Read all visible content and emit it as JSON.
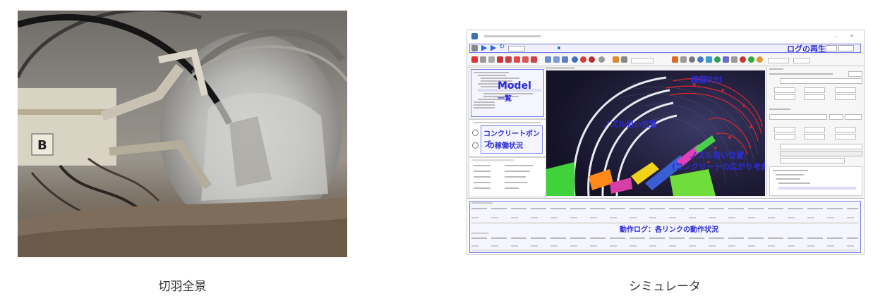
{
  "left_panel": {
    "caption": "切羽全景"
  },
  "right_panel": {
    "caption": "シミュレータ",
    "annotations": {
      "log_playback": "ログの再生",
      "model": "Model",
      "model_sub": "一覧",
      "pump_line1": "コンクリートポンプ",
      "pump_line2": "の稼働状況",
      "spray_tip": "模擬吹付",
      "nozzle_pos": "ノズル狙い位置",
      "nozzle_pos2_line1": "ノズル狙い位置",
      "nozzle_pos2_line2": "(コンクリートの広がり考慮)",
      "motion_log": "動作ログ：各リンクの動作状況"
    }
  },
  "colors": {
    "annotation_text": "#2c2cd8",
    "highlight_border": "#7b7bf0",
    "viewport_bg": "#1b1830",
    "spray_red": "#e0262b"
  },
  "icons": [
    "play-icon",
    "play-alt-icon",
    "reload-icon",
    "gear-icon",
    "save-icon"
  ]
}
